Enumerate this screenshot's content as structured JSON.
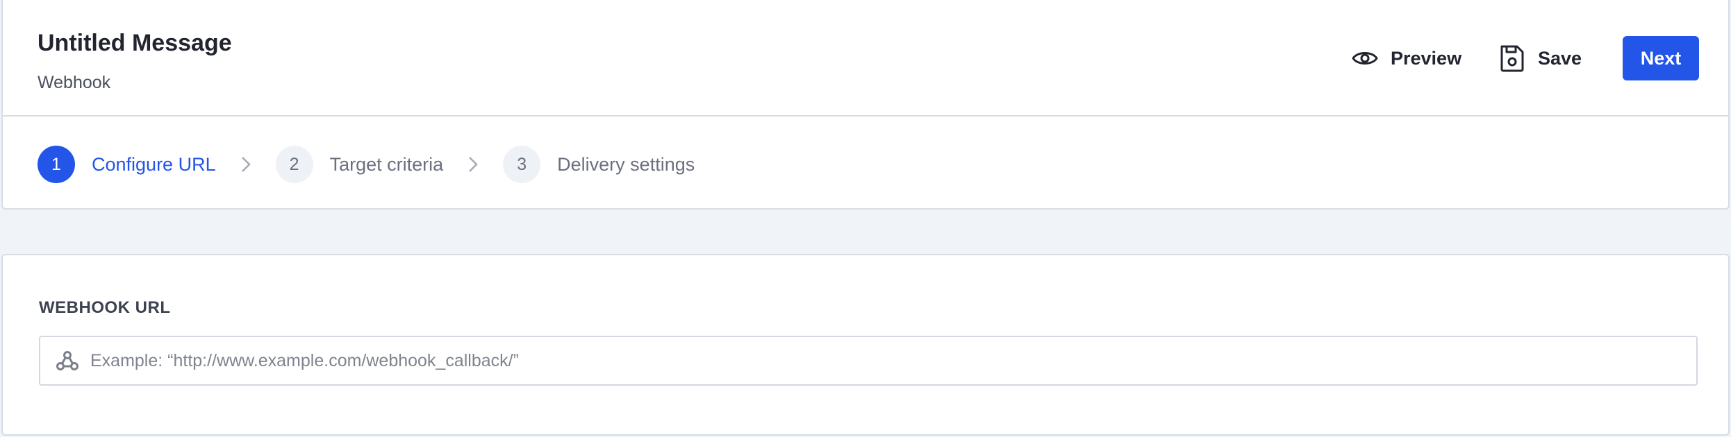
{
  "header": {
    "title": "Untitled Message",
    "subtitle": "Webhook",
    "actions": {
      "preview_label": "Preview",
      "save_label": "Save",
      "next_label": "Next"
    }
  },
  "steps": [
    {
      "number": "1",
      "label": "Configure URL",
      "state": "active"
    },
    {
      "number": "2",
      "label": "Target criteria",
      "state": "inactive"
    },
    {
      "number": "3",
      "label": "Delivery settings",
      "state": "inactive"
    }
  ],
  "form": {
    "webhook_url_label": "WEBHOOK URL",
    "webhook_url_value": "",
    "webhook_url_placeholder": "Example: “http://www.example.com/webhook_callback/”"
  },
  "colors": {
    "accent": "#2255e8",
    "background": "#f0f3f8",
    "border": "#d8dce5",
    "muted_text": "#6b7080"
  },
  "icons": {
    "preview": "eye-icon",
    "save": "save-icon",
    "step_separator": "chevron-right-icon",
    "webhook_field": "webhook-icon"
  }
}
